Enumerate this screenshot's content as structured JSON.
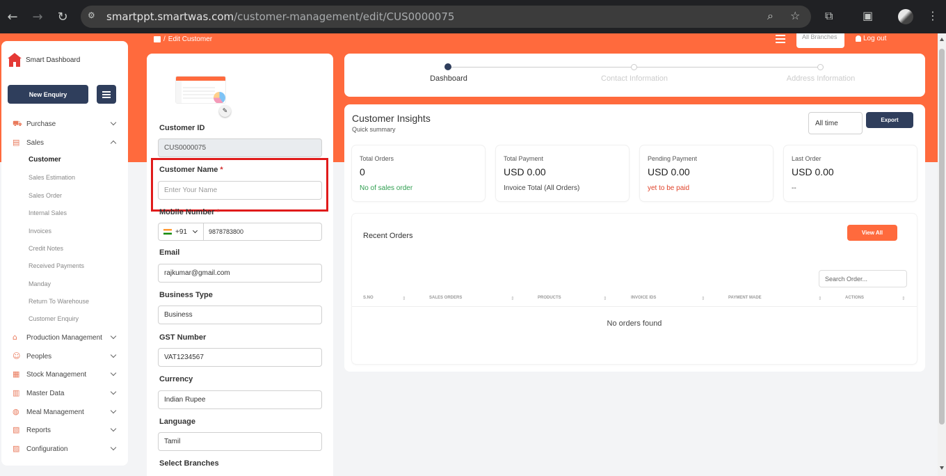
{
  "browser": {
    "url_host": "smartppt.smartwas.com",
    "url_path": "/customer-management/edit/CUS0000075"
  },
  "header": {
    "breadcrumb": "Edit Customer",
    "branches": "All Branches",
    "logout": "Log out"
  },
  "sidebar": {
    "brand": "Smart Dashboard",
    "new_enquiry": "New Enquiry",
    "items": [
      {
        "label": "Purchase",
        "icon": "cart-icon"
      },
      {
        "label": "Sales",
        "icon": "bag-icon"
      },
      {
        "label": "Production Management",
        "icon": "factory-icon"
      },
      {
        "label": "Peoples",
        "icon": "people-icon"
      },
      {
        "label": "Stock Management",
        "icon": "box-icon"
      },
      {
        "label": "Master Data",
        "icon": "table-icon"
      },
      {
        "label": "Meal Management",
        "icon": "meal-icon"
      },
      {
        "label": "Reports",
        "icon": "report-icon"
      },
      {
        "label": "Configuration",
        "icon": "config-icon"
      }
    ],
    "sales_sub": [
      "Customer",
      "Sales Estimation",
      "Sales Order",
      "Internal Sales",
      "Invoices",
      "Credit Notes",
      "Received Payments",
      "Manday",
      "Return To Warehouse",
      "Customer Enquiry"
    ]
  },
  "form": {
    "customer_id_label": "Customer ID",
    "customer_id_value": "CUS0000075",
    "customer_name_label": "Customer Name",
    "customer_name_placeholder": "Enter Your Name",
    "mobile_label": "Mobile Number",
    "country_code": "+91",
    "mobile_value": "9878783800",
    "email_label": "Email",
    "email_value": "rajkumar@gmail.com",
    "business_type_label": "Business Type",
    "business_type_value": "Business",
    "gst_label": "GST Number",
    "gst_value": "VAT1234567",
    "currency_label": "Currency",
    "currency_value": "Indian Rupee",
    "language_label": "Language",
    "language_value": "Tamil",
    "branches_label": "Select Branches",
    "required_mark": "*"
  },
  "stepper": {
    "steps": [
      "Dashboard",
      "Contact Information",
      "Address Information"
    ]
  },
  "insights": {
    "title": "Customer Insights",
    "subtitle": "Quick summary",
    "time_filter": "All time",
    "export": "Export",
    "stats": [
      {
        "label": "Total Orders",
        "value": "0",
        "note": "No of sales order"
      },
      {
        "label": "Total Payment",
        "value": "USD 0.00",
        "note": "Invoice Total (All Orders)"
      },
      {
        "label": "Pending Payment",
        "value": "USD 0.00",
        "note": "yet to be paid"
      },
      {
        "label": "Last Order",
        "value": "USD 0.00",
        "note": "--"
      }
    ],
    "recent_orders": {
      "title": "Recent Orders",
      "view_all": "View All",
      "search_placeholder": "Search Order...",
      "columns": [
        "S.NO",
        "SALES ORDERS",
        "PRODUCTS",
        "INVOICE IDS",
        "PAYMENT MADE",
        "ACTIONS"
      ],
      "empty_text": "No orders found"
    }
  }
}
